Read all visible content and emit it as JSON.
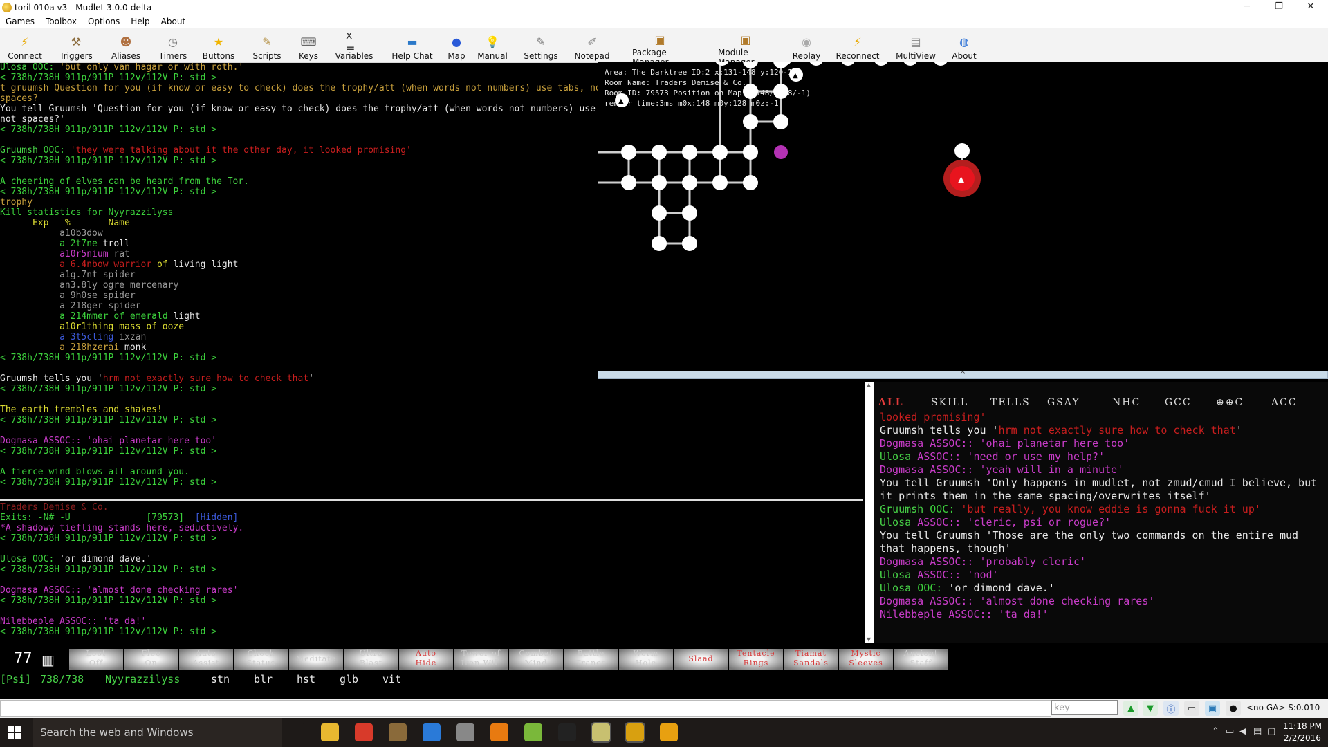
{
  "window": {
    "title": "toril 010a v3 - Mudlet 3.0.0-delta",
    "minimize": "─",
    "maximize": "❐",
    "close": "✕"
  },
  "menu": [
    "Games",
    "Toolbox",
    "Options",
    "Help",
    "About"
  ],
  "toolbar": [
    {
      "label": "Connect",
      "icon": "connect-icon",
      "glyph": "⚡",
      "color": "#e8a800"
    },
    {
      "label": "Triggers",
      "icon": "triggers-icon",
      "glyph": "⚒",
      "color": "#8a6a3a"
    },
    {
      "label": "Aliases",
      "icon": "aliases-icon",
      "glyph": "☻",
      "color": "#b07040"
    },
    {
      "label": "Timers",
      "icon": "timers-icon",
      "glyph": "◷",
      "color": "#777"
    },
    {
      "label": "Buttons",
      "icon": "buttons-icon",
      "glyph": "★",
      "color": "#f0b400"
    },
    {
      "label": "Scripts",
      "icon": "scripts-icon",
      "glyph": "✎",
      "color": "#b08a3a"
    },
    {
      "label": "Keys",
      "icon": "keys-icon",
      "glyph": "⌨",
      "color": "#666"
    },
    {
      "label": "Variables",
      "icon": "variables-icon",
      "glyph": "x =",
      "color": "#333"
    },
    {
      "label": "Help Chat",
      "icon": "help-chat-icon",
      "glyph": "▬",
      "color": "#2a78c8"
    },
    {
      "label": "Map",
      "icon": "map-icon",
      "glyph": "●",
      "color": "#2a5ad8"
    },
    {
      "label": "Manual",
      "icon": "manual-icon",
      "glyph": "💡",
      "color": "#e8c000"
    },
    {
      "label": "Settings",
      "icon": "settings-icon",
      "glyph": "✎",
      "color": "#777"
    },
    {
      "label": "Notepad",
      "icon": "notepad-icon",
      "glyph": "✐",
      "color": "#888"
    },
    {
      "label": "Package Manager",
      "icon": "package-manager-icon",
      "glyph": "▣",
      "color": "#b07a2a"
    },
    {
      "label": "Module Manager",
      "icon": "module-manager-icon",
      "glyph": "▣",
      "color": "#b07a2a"
    },
    {
      "label": "Replay",
      "icon": "replay-icon",
      "glyph": "◉",
      "color": "#aaa"
    },
    {
      "label": "Reconnect",
      "icon": "reconnect-icon",
      "glyph": "⚡",
      "color": "#e8a800"
    },
    {
      "label": "MultiView",
      "icon": "multiview-icon",
      "glyph": "▤",
      "color": "#888"
    },
    {
      "label": "About",
      "icon": "about-icon",
      "glyph": "◍",
      "color": "#3a7ad8"
    }
  ],
  "main_log": [
    [
      {
        "t": "Ulosa ",
        "c": "p"
      },
      {
        "t": "OOC: ",
        "c": "g"
      },
      {
        "t": "'but only van hagar or with roth.'",
        "c": "o"
      }
    ],
    [
      {
        "t": "< 738h/738H 911p/911P 112v/112V P: std >",
        "c": "g"
      }
    ],
    [
      {
        "t": "t gruumsh Question for you (if know or easy to check) does the trophy/att (when words not numbers) use tabs, not",
        "c": "o"
      }
    ],
    [
      {
        "t": "spaces?",
        "c": "o"
      }
    ],
    [
      {
        "t": "You tell Gruumsh 'Question for you (if know or easy to check) does the trophy/att (when words not numbers) use tabs,",
        "c": "w"
      }
    ],
    [
      {
        "t": "not spaces?'",
        "c": "w"
      }
    ],
    [
      {
        "t": "< 738h/738H 911p/911P 112v/112V P: std >",
        "c": "g"
      }
    ],
    [
      {
        "t": "",
        "c": "g"
      }
    ],
    [
      {
        "t": "Gruumsh ",
        "c": "p"
      },
      {
        "t": "OOC: ",
        "c": "g"
      },
      {
        "t": "'they were talking about it the other day, it looked promising'",
        "c": "r"
      }
    ],
    [
      {
        "t": "< 738h/738H 911p/911P 112v/112V P: std >",
        "c": "g"
      }
    ],
    [
      {
        "t": "",
        "c": "g"
      }
    ],
    [
      {
        "t": "A cheering of ",
        "c": "g"
      },
      {
        "t": "elves",
        "c": "p"
      },
      {
        "t": " can be heard from the ",
        "c": "g"
      },
      {
        "t": "Tor.",
        "c": "p"
      }
    ],
    [
      {
        "t": "< 738h/738H 911p/911P 112v/112V P: std >",
        "c": "g"
      }
    ],
    [
      {
        "t": "trophy",
        "c": "o"
      }
    ],
    [
      {
        "t": "Kill statistics for Nyyrazzilyss",
        "c": "g"
      }
    ],
    [
      {
        "t": "      Exp   %       Name",
        "c": "y"
      }
    ],
    [
      {
        "t": "           a10b3dow",
        "c": "gr"
      }
    ],
    [
      {
        "t": "           a 2t7ne ",
        "c": "g"
      },
      {
        "t": "troll",
        "c": "w"
      }
    ],
    [
      {
        "t": "           a10r5nium ",
        "c": "m"
      },
      {
        "t": "rat",
        "c": "gr"
      }
    ],
    [
      {
        "t": "           a 6.4nbow ",
        "c": "r"
      },
      {
        "t": "warrior",
        "c": "r"
      },
      {
        "t": " of ",
        "c": "y"
      },
      {
        "t": "living light",
        "c": "w"
      }
    ],
    [
      {
        "t": "           a1g.7nt spider",
        "c": "gr"
      }
    ],
    [
      {
        "t": "           an3.8ly ogre mercenary",
        "c": "gr"
      }
    ],
    [
      {
        "t": "           a 9h0se spider",
        "c": "gr"
      }
    ],
    [
      {
        "t": "           a 218ger spider",
        "c": "gr"
      }
    ],
    [
      {
        "t": "           a 214mmer ",
        "c": "g"
      },
      {
        "t": "of emerald ",
        "c": "g"
      },
      {
        "t": "light",
        "c": "w"
      }
    ],
    [
      {
        "t": "           a10r1thing mass of ooze",
        "c": "y"
      }
    ],
    [
      {
        "t": "           a 3t5cling ",
        "c": "b"
      },
      {
        "t": "ixzan",
        "c": "gr"
      }
    ],
    [
      {
        "t": "           a 218hzerai ",
        "c": "o"
      },
      {
        "t": "monk",
        "c": "w"
      }
    ],
    [
      {
        "t": "< 738h/738H 911p/911P 112v/112V P: std >",
        "c": "g"
      }
    ],
    [
      {
        "t": "",
        "c": "g"
      }
    ],
    [
      {
        "t": "Gruumsh tells you '",
        "c": "w"
      },
      {
        "t": "hrm not exactly sure how to check that",
        "c": "r"
      },
      {
        "t": "'",
        "c": "w"
      }
    ],
    [
      {
        "t": "< 738h/738H 911p/911P 112v/112V P: std >",
        "c": "g"
      }
    ],
    [
      {
        "t": "",
        "c": "g"
      }
    ],
    [
      {
        "t": "The earth trembles and shakes!",
        "c": "y"
      }
    ],
    [
      {
        "t": "< 738h/738H 911p/911P 112v/112V P: std >",
        "c": "g"
      }
    ],
    [
      {
        "t": "",
        "c": "g"
      }
    ],
    [
      {
        "t": "Dogmasa ",
        "c": "m"
      },
      {
        "t": "ASSOC:: ",
        "c": "m"
      },
      {
        "t": "'ohai planetar here too'",
        "c": "m"
      }
    ],
    [
      {
        "t": "< 738h/738H 911p/911P 112v/112V P: std >",
        "c": "g"
      }
    ],
    [
      {
        "t": "",
        "c": "g"
      }
    ],
    [
      {
        "t": "A fierce wind blows all around you.",
        "c": "g"
      }
    ],
    [
      {
        "t": "< 738h/738H 911p/911P 112v/112V P: std >",
        "c": "g"
      }
    ]
  ],
  "lower_log": [
    [
      {
        "t": "Traders Demise & Co.",
        "c": "dr"
      }
    ],
    [
      {
        "t": "Exits: -N# -U              [79573]  ",
        "c": "g"
      },
      {
        "t": "[Hidden]",
        "c": "b"
      }
    ],
    [
      {
        "t": "*A shadowy tiefling stands here, seductively.",
        "c": "m"
      }
    ],
    [
      {
        "t": "< 738h/738H 911p/911P 112v/112V P: std >",
        "c": "g"
      }
    ],
    [
      {
        "t": "",
        "c": "g"
      }
    ],
    [
      {
        "t": "Ulosa ",
        "c": "p"
      },
      {
        "t": "OOC: ",
        "c": "g"
      },
      {
        "t": "'or dimond dave.'",
        "c": "w"
      }
    ],
    [
      {
        "t": "< 738h/738H 911p/911P 112v/112V P: std >",
        "c": "g"
      }
    ],
    [
      {
        "t": "",
        "c": "g"
      }
    ],
    [
      {
        "t": "Dogmasa ",
        "c": "m"
      },
      {
        "t": "ASSOC:: ",
        "c": "m"
      },
      {
        "t": "'almost done checking rares'",
        "c": "m"
      }
    ],
    [
      {
        "t": "< 738h/738H 911p/911P 112v/112V P: std >",
        "c": "g"
      }
    ],
    [
      {
        "t": "",
        "c": "g"
      }
    ],
    [
      {
        "t": "Nilebbeple ",
        "c": "m"
      },
      {
        "t": "ASSOC:: ",
        "c": "m"
      },
      {
        "t": "'ta da!'",
        "c": "m"
      }
    ],
    [
      {
        "t": "< 738h/738H 911p/911P 112v/112V P: std >",
        "c": "g"
      }
    ]
  ],
  "map": {
    "info": [
      "Area: The Darktree ID:2 x:131-148 y:120-135",
      "Room Name: Traders Demise & Co.",
      "Room ID: 79573 Position on Map: (148/-128/-1)",
      "render time:3ms m0x:148 m0y:128 m0z:-1"
    ],
    "splitter_glyph": "^"
  },
  "chat": {
    "tabs": [
      "ALL",
      "SKILL",
      "TELLS",
      "GSAY",
      "NHC",
      "GCC",
      "⊕⊕C",
      "ACC"
    ],
    "lines": [
      [
        {
          "t": "looked promising'",
          "c": "r"
        }
      ],
      [
        {
          "t": "Gruumsh tells you '",
          "c": "w"
        },
        {
          "t": "hrm not exactly sure how to check that",
          "c": "r"
        },
        {
          "t": "'",
          "c": "w"
        }
      ],
      [
        {
          "t": "Dogmasa ",
          "c": "m"
        },
        {
          "t": "ASSOC:: 'ohai planetar here too'",
          "c": "m"
        }
      ],
      [
        {
          "t": "Ulosa ",
          "c": "p"
        },
        {
          "t": "ASSOC:: 'need or use my help?'",
          "c": "m"
        }
      ],
      [
        {
          "t": "Dogmasa ",
          "c": "m"
        },
        {
          "t": "ASSOC:: 'yeah will in a minute'",
          "c": "m"
        }
      ],
      [
        {
          "t": "You tell Gruumsh 'Only happens in mudlet, not zmud/cmud I believe, but it prints them in the same spacing/overwrites itself'",
          "c": "w"
        }
      ],
      [
        {
          "t": "Gruumsh ",
          "c": "p"
        },
        {
          "t": "OOC: ",
          "c": "g"
        },
        {
          "t": "'but really, you know eddie is gonna fuck it up'",
          "c": "r"
        }
      ],
      [
        {
          "t": "Ulosa ",
          "c": "p"
        },
        {
          "t": "ASSOC:: 'cleric, psi or rogue?'",
          "c": "m"
        }
      ],
      [
        {
          "t": "You tell Gruumsh 'Those are the only two commands on the entire mud that happens, though'",
          "c": "w"
        }
      ],
      [
        {
          "t": "Dogmasa ",
          "c": "m"
        },
        {
          "t": "ASSOC:: 'probably cleric'",
          "c": "m"
        }
      ],
      [
        {
          "t": "Ulosa ",
          "c": "p"
        },
        {
          "t": "ASSOC:: 'nod'",
          "c": "m"
        }
      ],
      [
        {
          "t": "Ulosa ",
          "c": "p"
        },
        {
          "t": "OOC: ",
          "c": "g"
        },
        {
          "t": "'or dimond dave.'",
          "c": "w"
        }
      ],
      [
        {
          "t": "Dogmasa ",
          "c": "m"
        },
        {
          "t": "ASSOC:: 'almost done checking rares'",
          "c": "m"
        }
      ],
      [
        {
          "t": "Nilebbeple ",
          "c": "m"
        },
        {
          "t": "ASSOC:: 'ta da!'",
          "c": "m"
        }
      ]
    ]
  },
  "buttons_bar": {
    "counter": "77",
    "counter_icon": "▥",
    "buttons": [
      {
        "l1": "Loot",
        "l2": "Off",
        "red": false
      },
      {
        "l1": "Flee",
        "l2": "On",
        "red": false
      },
      {
        "l1": "Auto",
        "l2": "Assist",
        "red": false
      },
      {
        "l1": "Check",
        "l2": "Status",
        "red": false
      },
      {
        "l1": "Meditate",
        "l2": "",
        "red": false
      },
      {
        "l1": "Ultra",
        "l2": "Blast",
        "red": false
      },
      {
        "l1": "Auto",
        "l2": "Hide",
        "red": true
      },
      {
        "l1": "Tower of",
        "l2": "Iron Will",
        "red": false
      },
      {
        "l1": "Combat",
        "l2": "Mind",
        "red": false
      },
      {
        "l1": "Battle",
        "l2": "Trance",
        "red": false
      },
      {
        "l1": "Worm",
        "l2": "Hole",
        "red": false
      },
      {
        "l1": "Slaad",
        "l2": "",
        "red": true
      },
      {
        "l1": "Tentacle",
        "l2": "Rings",
        "red": true
      },
      {
        "l1": "Tiamat",
        "l2": "Sandals",
        "red": true
      },
      {
        "l1": "Mystic",
        "l2": "Sleeves",
        "red": true
      },
      {
        "l1": "Ancient",
        "l2": "Staff",
        "red": false
      }
    ]
  },
  "status": {
    "cls": "[Psi]",
    "hp": "738/738",
    "name": "Nyyrazzilyss",
    "affects": [
      "stn",
      "blr",
      "hst",
      "glb",
      "vit"
    ]
  },
  "cmdline": {
    "value": "",
    "key_placeholder": "key",
    "ga_status": "<no GA> S:0.010"
  },
  "taskbar": {
    "search_placeholder": "Search the web and Windows",
    "time": "11:18 PM",
    "date": "2/2/2016"
  }
}
